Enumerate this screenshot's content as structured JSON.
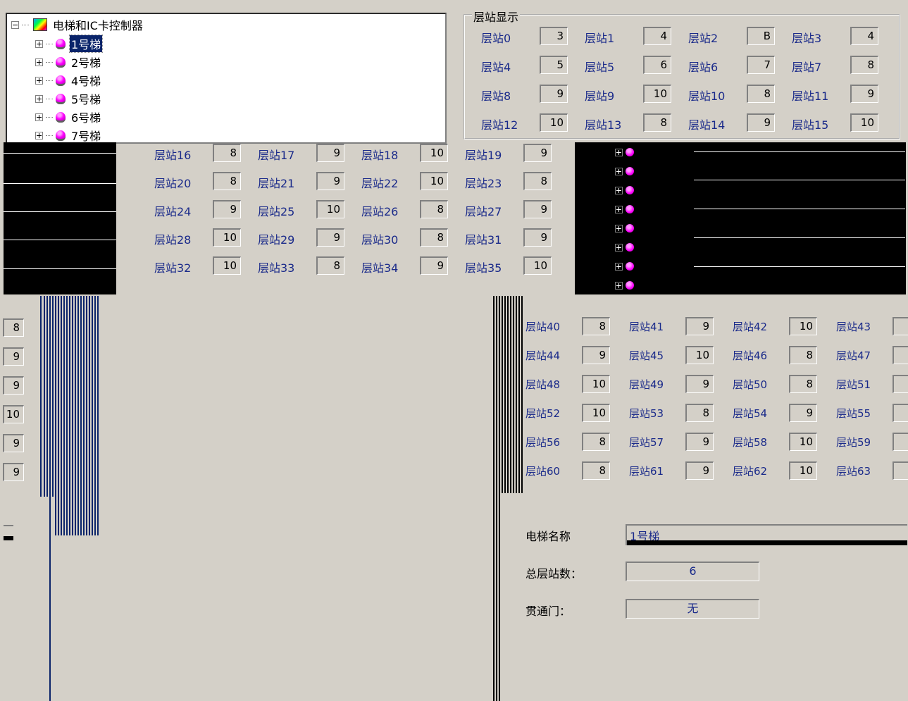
{
  "tree": {
    "root_label": "电梯和IC卡控制器",
    "items": [
      {
        "label": "1号梯",
        "selected": true
      },
      {
        "label": "2号梯",
        "selected": false
      },
      {
        "label": "4号梯",
        "selected": false
      },
      {
        "label": "5号梯",
        "selected": false
      },
      {
        "label": "6号梯",
        "selected": false
      },
      {
        "label": "7号梯",
        "selected": false
      }
    ]
  },
  "station_group": {
    "title": "层站显示",
    "rows_top": [
      [
        [
          "层站0",
          "3"
        ],
        [
          "层站1",
          "4"
        ],
        [
          "层站2",
          "B"
        ],
        [
          "层站3",
          "4"
        ]
      ],
      [
        [
          "层站4",
          "5"
        ],
        [
          "层站5",
          "6"
        ],
        [
          "层站6",
          "7"
        ],
        [
          "层站7",
          "8"
        ]
      ],
      [
        [
          "层站8",
          "9"
        ],
        [
          "层站9",
          "10"
        ],
        [
          "层站10",
          "8"
        ],
        [
          "层站11",
          "9"
        ]
      ],
      [
        [
          "层站12",
          "10"
        ],
        [
          "层站13",
          "8"
        ],
        [
          "层站14",
          "9"
        ],
        [
          "层站15",
          "10"
        ]
      ]
    ],
    "rows_mid": [
      [
        [
          "层站16",
          "8"
        ],
        [
          "层站17",
          "9"
        ],
        [
          "层站18",
          "10"
        ],
        [
          "层站19",
          "9"
        ]
      ],
      [
        [
          "层站20",
          "8"
        ],
        [
          "层站21",
          "9"
        ],
        [
          "层站22",
          "10"
        ],
        [
          "层站23",
          "8"
        ]
      ],
      [
        [
          "层站24",
          "9"
        ],
        [
          "层站25",
          "10"
        ],
        [
          "层站26",
          "8"
        ],
        [
          "层站27",
          "9"
        ]
      ],
      [
        [
          "层站28",
          "10"
        ],
        [
          "层站29",
          "9"
        ],
        [
          "层站30",
          "8"
        ],
        [
          "层站31",
          "9"
        ]
      ],
      [
        [
          "层站32",
          "10"
        ],
        [
          "层站33",
          "8"
        ],
        [
          "层站34",
          "9"
        ],
        [
          "层站35",
          "10"
        ]
      ]
    ],
    "rows_low": [
      [
        [
          "层站40",
          "8"
        ],
        [
          "层站41",
          "9"
        ],
        [
          "层站42",
          "10"
        ],
        [
          "层站43",
          ""
        ]
      ],
      [
        [
          "层站44",
          "9"
        ],
        [
          "层站45",
          "10"
        ],
        [
          "层站46",
          "8"
        ],
        [
          "层站47",
          ""
        ]
      ],
      [
        [
          "层站48",
          "10"
        ],
        [
          "层站49",
          "9"
        ],
        [
          "层站50",
          "8"
        ],
        [
          "层站51",
          ""
        ]
      ],
      [
        [
          "层站52",
          "10"
        ],
        [
          "层站53",
          "8"
        ],
        [
          "层站54",
          "9"
        ],
        [
          "层站55",
          ""
        ]
      ],
      [
        [
          "层站56",
          "8"
        ],
        [
          "层站57",
          "9"
        ],
        [
          "层站58",
          "10"
        ],
        [
          "层站59",
          ""
        ]
      ],
      [
        [
          "层站60",
          "8"
        ],
        [
          "层站61",
          "9"
        ],
        [
          "层站62",
          "10"
        ],
        [
          "层站63",
          ""
        ]
      ]
    ],
    "left_strip_values": [
      "8",
      "9",
      "9",
      "10",
      "9",
      "9"
    ]
  },
  "details": {
    "name_label": "电梯名称",
    "name_value": "1号梯",
    "floors_label": "总层站数：",
    "floors_value": "6",
    "through_door_label": "贯通门：",
    "through_door_value": "无"
  }
}
